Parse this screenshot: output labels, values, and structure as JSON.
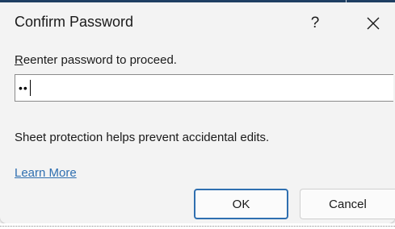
{
  "dialog": {
    "title": "Confirm Password",
    "help_label": "?",
    "close_icon": "close-icon",
    "prompt": {
      "access_key": "R",
      "rest": "eenter password to proceed."
    },
    "password_value": "••",
    "info": "Sheet protection helps prevent accidental edits.",
    "learn_more": "Learn More",
    "ok_label": "OK",
    "cancel_label": "Cancel"
  },
  "colors": {
    "accent": "#2f6fb0",
    "dialog_bg": "#f3f3f3",
    "window_strip": "#1f3f63"
  }
}
